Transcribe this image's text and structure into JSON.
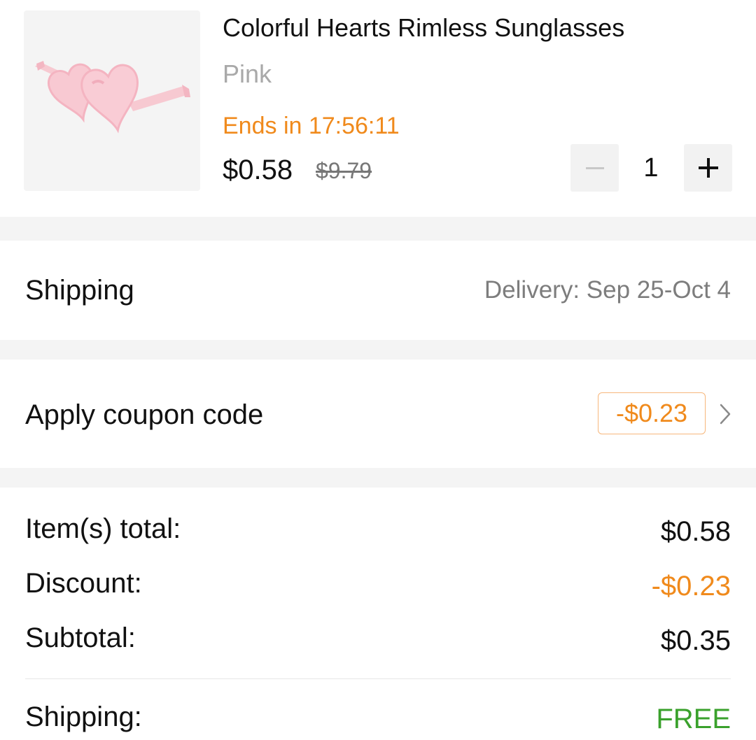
{
  "product": {
    "title": "Colorful Hearts Rimless Sunglasses",
    "variant": "Pink",
    "countdown": "Ends in 17:56:11",
    "price": "$0.58",
    "original_price": "$9.79",
    "quantity": "1",
    "image_icon": "heart-sunglasses",
    "colors": {
      "accent_orange": "#f08a1c",
      "free_green": "#3aa12c"
    }
  },
  "shipping": {
    "label": "Shipping",
    "delivery": "Delivery: Sep 25-Oct 4"
  },
  "coupon": {
    "label": "Apply coupon code",
    "amount": "-$0.23"
  },
  "summary": {
    "items_total_label": "Item(s) total:",
    "items_total_value": "$0.58",
    "discount_label": "Discount:",
    "discount_value": "-$0.23",
    "subtotal_label": "Subtotal:",
    "subtotal_value": "$0.35",
    "shipping_label": "Shipping:",
    "shipping_value": "FREE"
  }
}
